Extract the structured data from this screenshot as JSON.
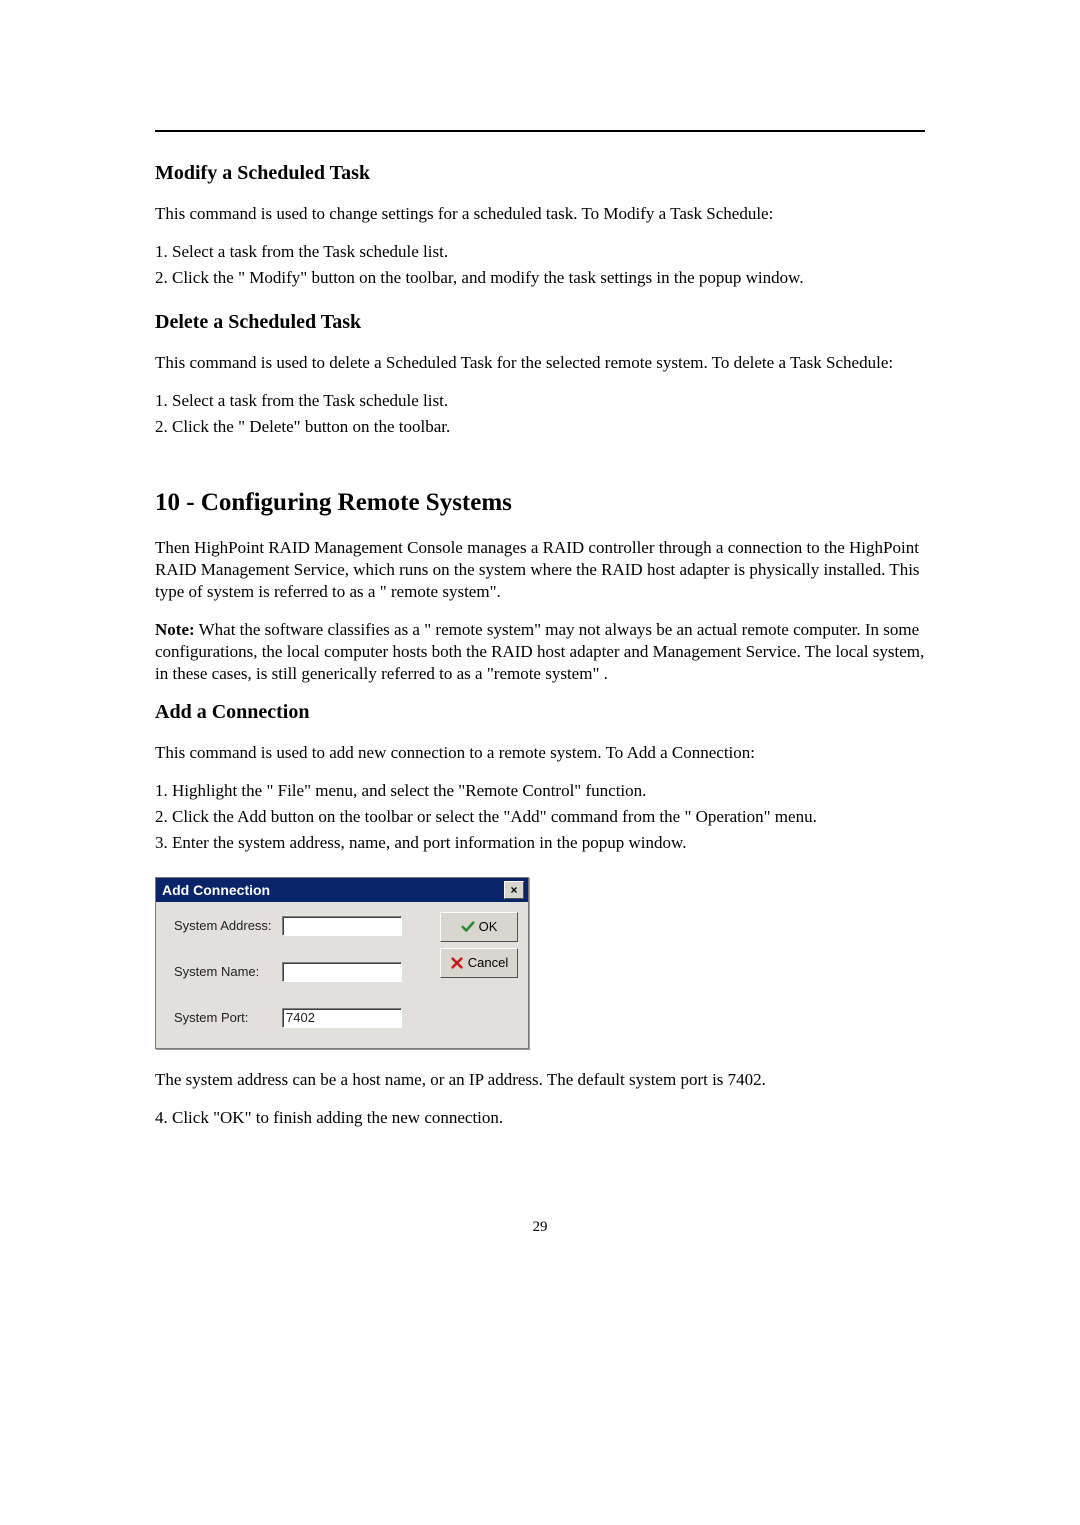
{
  "section_modify": {
    "heading": "Modify a Scheduled Task",
    "intro": "This command is used to change settings for a scheduled task.  To Modify a Task Schedule:",
    "step1": "1. Select a task from the Task schedule list.",
    "step2": "2. Click the \" Modify\" button on the toolbar, and modify the task settings in the popup window."
  },
  "section_delete": {
    "heading": "Delete a Scheduled Task",
    "intro": "This command is used to delete a Scheduled Task for the selected remote system.  To delete a Task Schedule:",
    "step1": "1. Select a task from the Task schedule list.",
    "step2": "2. Click the \" Delete\"  button on the toolbar."
  },
  "section_config": {
    "heading": "10 - Configuring Remote Systems",
    "para1": "Then HighPoint RAID Management Console manages a RAID controller through a connection to the HighPoint RAID Management Service, which runs on the system where the RAID host adapter is physically installed.  This type of system is referred to as a \" remote system\".",
    "note_label": "Note:",
    "note_body": " What the software classifies as a \" remote system\"  may not always be an actual remote computer.   In some configurations, the local computer hosts both the RAID host adapter and Management Service.  The local system, in these cases, is still generically referred to as a \"remote system\" ."
  },
  "section_add": {
    "heading": "Add a Connection",
    "intro": "This command is used to add new connection to a remote system.  To Add a Connection:",
    "step1": "1. Highlight the \" File\" menu, and select the \"Remote Control\"  function.",
    "step2": "2. Click the Add button on the toolbar or select the \"Add\" command from the \" Operation\"  menu.",
    "step3": "3. Enter the system address, name, and port information in the popup window.",
    "after1": "The system address can be a host name, or an IP address.  The default system port is 7402.",
    "after2": "4. Click \"OK\"  to finish adding the new connection."
  },
  "dialog": {
    "title": "Add Connection",
    "close_glyph": "×",
    "labels": {
      "address": "System Address:",
      "name": "System Name:",
      "port": "System Port:"
    },
    "values": {
      "address": "",
      "name": "",
      "port": "7402"
    },
    "buttons": {
      "ok": "OK",
      "cancel": "Cancel"
    }
  },
  "page_number": "29"
}
